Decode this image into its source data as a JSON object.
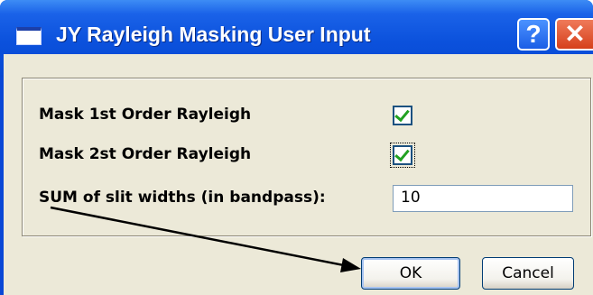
{
  "window": {
    "title": "JY Rayleigh Masking User Input",
    "help_glyph": "?",
    "close_glyph": "✕"
  },
  "form": {
    "mask1_label": "Mask 1st Order Rayleigh",
    "mask1_checked": true,
    "mask2_label": "Mask 2st Order Rayleigh",
    "mask2_checked": true,
    "slit_label": "SUM of slit widths (in bandpass):",
    "slit_value": "10"
  },
  "buttons": {
    "ok_label": "OK",
    "cancel_label": "Cancel"
  },
  "colors": {
    "titlebar": "#0b51dc",
    "client": "#ece9d8",
    "checkmark": "#21a121"
  },
  "icons": {
    "app": "window-icon",
    "help": "help-icon",
    "close": "close-icon",
    "annotation": "arrow-icon"
  }
}
